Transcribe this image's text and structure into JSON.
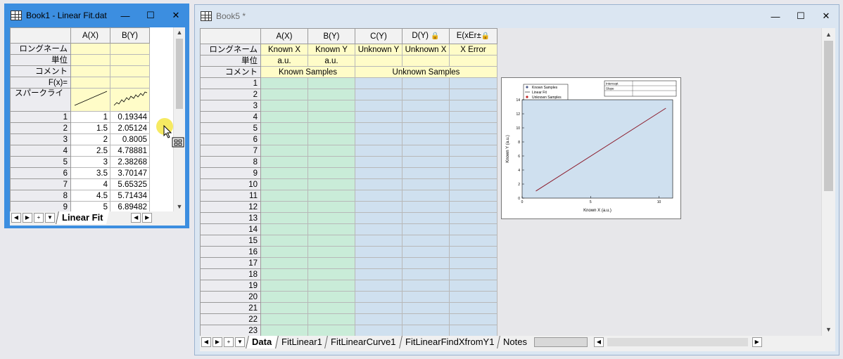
{
  "win1": {
    "title": "Book1 - Linear Fit.dat",
    "buttons": {
      "min": "—",
      "max": "☐",
      "close": "✕"
    },
    "columns": [
      "A(X)",
      "B(Y)"
    ],
    "row_labels": [
      "ロングネーム",
      "単位",
      "コメント",
      "F(x)=",
      "スパークライ"
    ],
    "data_rows": [
      {
        "n": "1",
        "a": "1",
        "b": "0.19344"
      },
      {
        "n": "2",
        "a": "1.5",
        "b": "2.05124"
      },
      {
        "n": "3",
        "a": "2",
        "b": "0.8005"
      },
      {
        "n": "4",
        "a": "2.5",
        "b": "4.78881"
      },
      {
        "n": "5",
        "a": "3",
        "b": "2.38268"
      },
      {
        "n": "6",
        "a": "3.5",
        "b": "3.70147"
      },
      {
        "n": "7",
        "a": "4",
        "b": "5.65325"
      },
      {
        "n": "8",
        "a": "4.5",
        "b": "5.71434"
      },
      {
        "n": "9",
        "a": "5",
        "b": "6.89482"
      }
    ],
    "tabs": [
      "Linear Fit"
    ]
  },
  "win2": {
    "title": "Book5 *",
    "buttons": {
      "min": "—",
      "max": "☐",
      "close": "✕"
    },
    "columns": [
      "A(X)",
      "B(Y)",
      "C(Y)",
      "D(Y)",
      "E(xEr±"
    ],
    "row_labels": [
      "ロングネーム",
      "単位",
      "コメント"
    ],
    "longnames": [
      "Known X",
      "Known Y",
      "Unknown Y",
      "Unknown X",
      "X Error"
    ],
    "units": [
      "a.u.",
      "a.u."
    ],
    "comments": [
      "Known Samples",
      "Unknown Samples"
    ],
    "row_numbers": [
      "1",
      "2",
      "3",
      "4",
      "5",
      "6",
      "7",
      "8",
      "9",
      "10",
      "11",
      "12",
      "13",
      "14",
      "15",
      "16",
      "17",
      "18",
      "19",
      "20",
      "21",
      "22",
      "23"
    ],
    "tabs": [
      "Data",
      "FitLinear1",
      "FitLinearCurve1",
      "FitLinearFindXfromY1",
      "Notes"
    ]
  },
  "chart_data": {
    "type": "line",
    "legend": [
      "Known Samples",
      "Linear Fit",
      "Unknown Samples"
    ],
    "table_rows": [
      "Intercept",
      "Slope",
      ""
    ],
    "xlabel": "Known X (a.u.)",
    "ylabel": "Known Y (a.u.)",
    "xlim": [
      0,
      11
    ],
    "ylim": [
      0,
      14
    ],
    "xticks": [
      "0",
      "5",
      "10"
    ],
    "yticks": [
      "0",
      "2",
      "4",
      "6",
      "8",
      "10",
      "12",
      "14"
    ],
    "series": [
      {
        "name": "Linear Fit",
        "x": [
          1,
          10.5
        ],
        "y": [
          1,
          12.8
        ]
      }
    ],
    "colors": {
      "line": "#8b1a2a",
      "plot_bg": "#cfe0ef"
    }
  }
}
